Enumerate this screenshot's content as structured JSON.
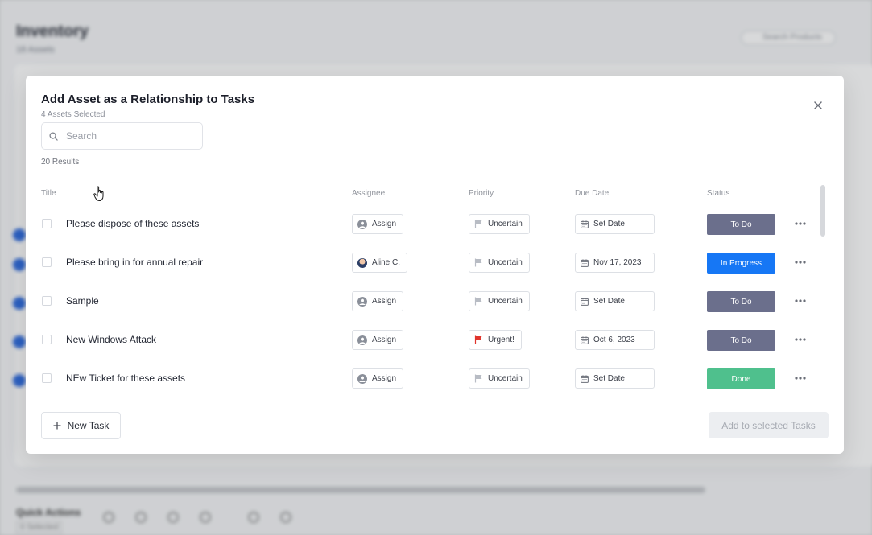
{
  "background": {
    "title": "Inventory",
    "subtitle": "18 Assets",
    "search_placeholder": "Search Products",
    "quick_actions": "Quick Actions",
    "quick_actions_sub": "0 Selected"
  },
  "modal": {
    "title": "Add Asset as a Relationship to Tasks",
    "subtitle": "4 Assets Selected",
    "search_placeholder": "Search",
    "results": "20 Results",
    "columns": {
      "title": "Title",
      "assignee": "Assignee",
      "priority": "Priority",
      "due_date": "Due Date",
      "status": "Status"
    },
    "rows": [
      {
        "title": "Please dispose of these assets",
        "assignee": "Assign",
        "assignee_avatar": false,
        "priority": "Uncertain",
        "priority_color": "#b8bcc4",
        "due": "Set Date",
        "status": "To Do",
        "status_color": "#6b6f8c"
      },
      {
        "title": "Please bring in for annual repair",
        "assignee": "Aline C.",
        "assignee_avatar": true,
        "priority": "Uncertain",
        "priority_color": "#b8bcc4",
        "due": "Nov 17, 2023",
        "status": "In Progress",
        "status_color": "#1677f5"
      },
      {
        "title": "Sample",
        "assignee": "Assign",
        "assignee_avatar": false,
        "priority": "Uncertain",
        "priority_color": "#b8bcc4",
        "due": "Set Date",
        "status": "To Do",
        "status_color": "#6b6f8c"
      },
      {
        "title": "New Windows Attack",
        "assignee": "Assign",
        "assignee_avatar": false,
        "priority": "Urgent!",
        "priority_color": "#e0342c",
        "due": "Oct 6, 2023",
        "status": "To Do",
        "status_color": "#6b6f8c"
      },
      {
        "title": "NEw Ticket for these assets",
        "assignee": "Assign",
        "assignee_avatar": false,
        "priority": "Uncertain",
        "priority_color": "#b8bcc4",
        "due": "Set Date",
        "status": "Done",
        "status_color": "#4fc08d"
      }
    ],
    "new_task_label": "New Task",
    "add_selected_label": "Add to selected Tasks"
  }
}
